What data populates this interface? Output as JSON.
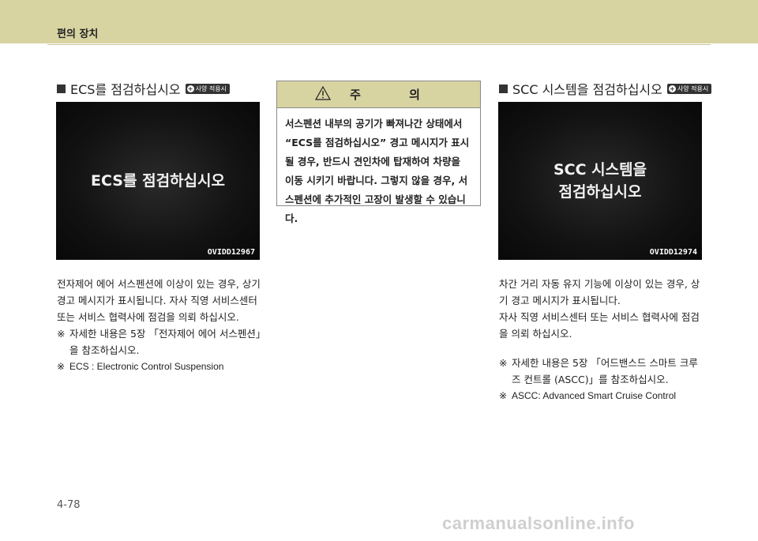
{
  "header": {
    "title": "편의 장치"
  },
  "left": {
    "title": "ECS를 점검하십시오",
    "badge": "사양 적용시",
    "screen": {
      "message": "ECS를 점검하십시오",
      "code": "OVIDD12967"
    },
    "paragraph": "전자제어 에어 서스펜션에 이상이 있는 경우, 상기 경고 메시지가 표시됩니다. 자사 직영 서비스센터 또는 서비스 협력사에 점검을 의뢰 하십시오.",
    "notes": [
      {
        "mark": "※",
        "text": "자세한 내용은 5장 「전자제어 에어 서스펜션」을 참조하십시오."
      },
      {
        "mark": "※",
        "text": "ECS : Electronic Control Suspension"
      }
    ]
  },
  "caution": {
    "title": "주 의",
    "icon": "warning-triangle-icon",
    "body": "서스펜션 내부의 공기가 빠져나간 상태에서 “ECS를 점검하십시오” 경고 메시지가 표시될 경우, 반드시 견인차에 탑재하여 차량을 이동 시키기 바랍니다. 그렇지 않을 경우, 서스펜션에 추가적인 고장이 발생할 수 있습니다."
  },
  "right": {
    "title": "SCC 시스템을 점검하십시오",
    "badge": "사양 적용시",
    "screen": {
      "line1": "SCC 시스템을",
      "line2": "점검하십시오",
      "code": "OVIDD12974"
    },
    "paragraph1": "차간 거리 자동 유지 기능에 이상이 있는 경우, 상기 경고 메시지가 표시됩니다.",
    "paragraph2": "자사 직영 서비스센터 또는 서비스 협력사에 점검을 의뢰 하십시오.",
    "notes": [
      {
        "mark": "※",
        "text": "자세한 내용은 5장 「어드밴스드 스마트 크루즈 컨트롤 (ASCC)」를 참조하십시오."
      },
      {
        "mark": "※",
        "text": "ASCC: Advanced Smart Cruise Control"
      }
    ]
  },
  "footer": {
    "page": "4-78",
    "watermark": "carmanualsonline.info"
  },
  "colors": {
    "band": "#d8d4a2",
    "screen": "#121212"
  }
}
